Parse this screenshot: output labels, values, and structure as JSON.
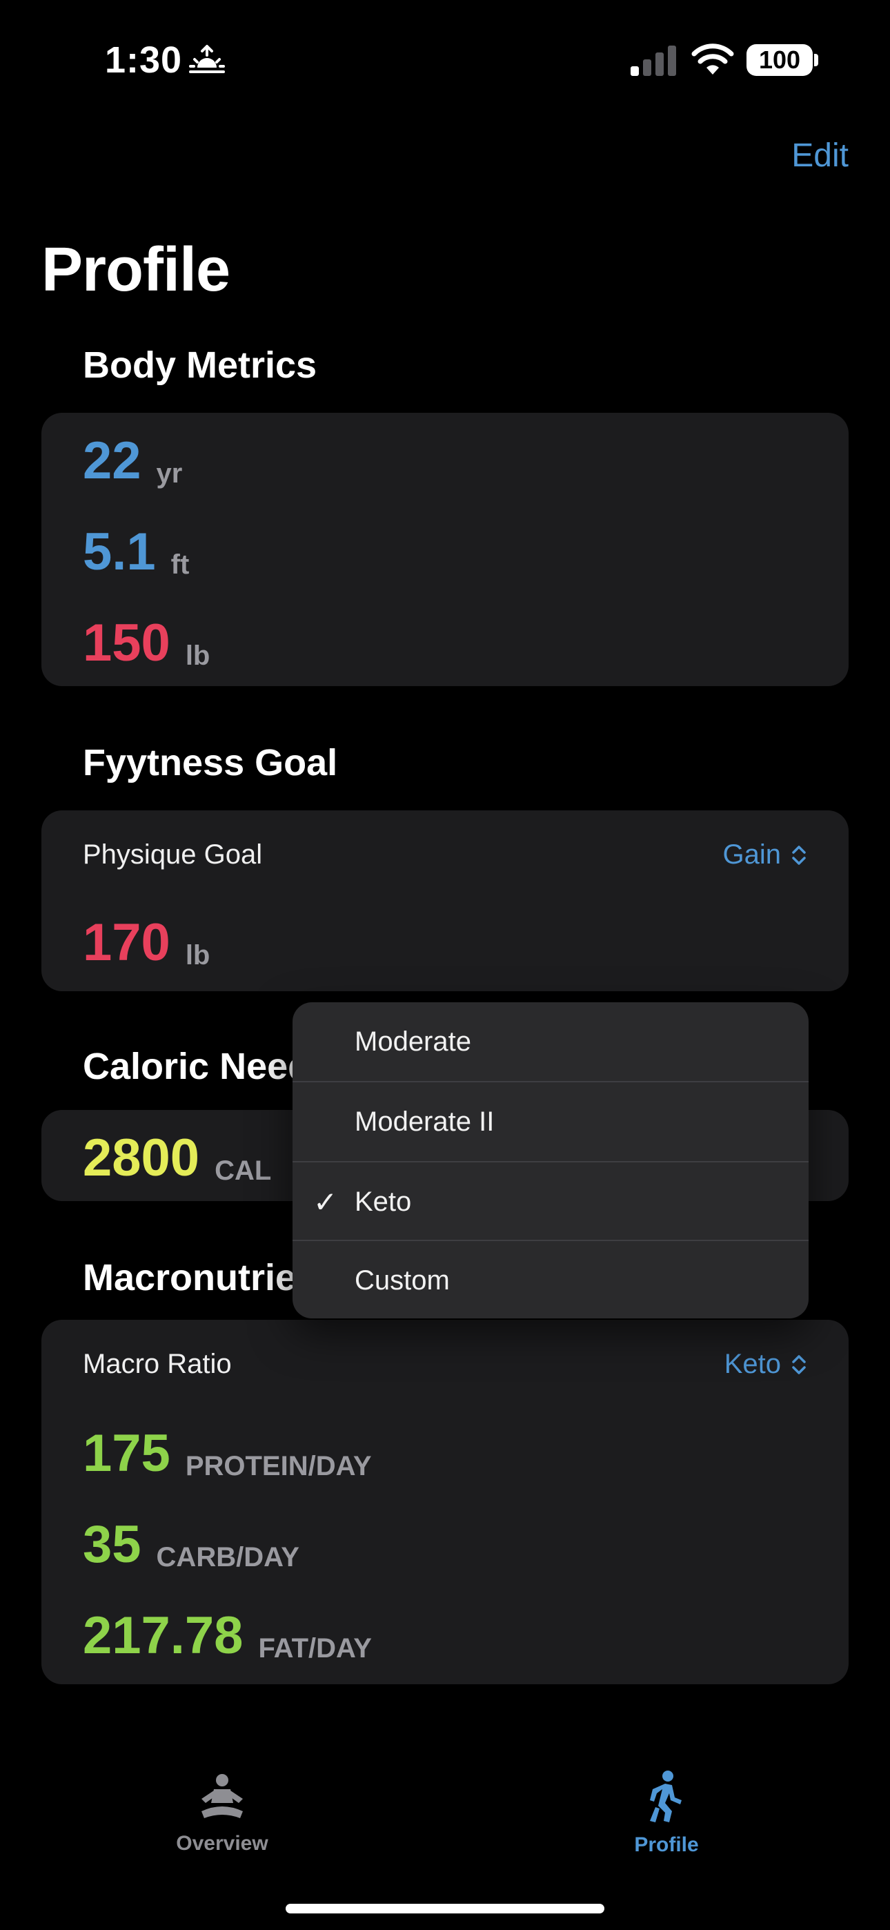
{
  "status_bar": {
    "time": "1:30",
    "battery": "100"
  },
  "header": {
    "edit_label": "Edit",
    "title": "Profile"
  },
  "body_metrics": {
    "title": "Body Metrics",
    "age": {
      "value": "22",
      "unit": "yr"
    },
    "height": {
      "value": "5.1",
      "unit": "ft"
    },
    "weight": {
      "value": "150",
      "unit": "lb"
    }
  },
  "fitness_goal": {
    "title": "Fyytness Goal",
    "physique_label": "Physique Goal",
    "physique_value": "Gain",
    "target": {
      "value": "170",
      "unit": "lb"
    }
  },
  "caloric_needs": {
    "title": "Caloric Need",
    "value": "2800",
    "unit": "CAL"
  },
  "macronutrients": {
    "title": "Macronutrien",
    "ratio_label": "Macro Ratio",
    "ratio_value": "Keto",
    "protein": {
      "value": "175",
      "unit": "PROTEIN/DAY"
    },
    "carb": {
      "value": "35",
      "unit": "CARB/DAY"
    },
    "fat": {
      "value": "217.78",
      "unit": "FAT/DAY"
    }
  },
  "menu": {
    "items": [
      {
        "label": "Moderate"
      },
      {
        "label": "Moderate II"
      },
      {
        "label": "Keto"
      },
      {
        "label": "Custom"
      }
    ],
    "selected": "Keto",
    "check": "✓"
  },
  "tab_bar": {
    "overview": "Overview",
    "profile": "Profile"
  },
  "colors": {
    "accent": "#4f97d6",
    "red": "#e8405c",
    "yellow": "#e4ec58",
    "green": "#8ed34a"
  }
}
